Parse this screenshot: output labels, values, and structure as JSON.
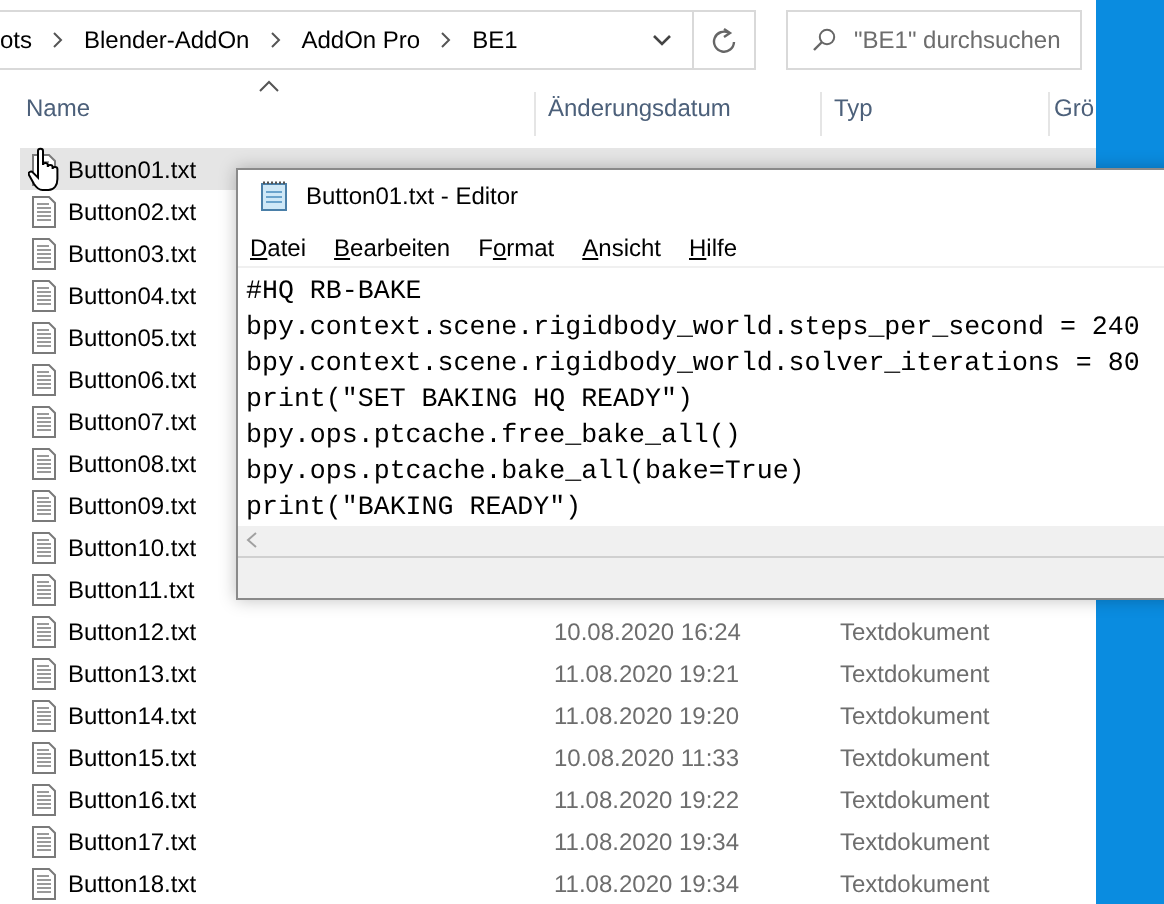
{
  "address_bar": {
    "path": [
      "ots",
      "Blender-AddOn",
      "AddOn Pro",
      "BE1"
    ]
  },
  "search": {
    "placeholder": "\"BE1\" durchsuchen"
  },
  "columns": [
    {
      "label": "Name",
      "sorted": true
    },
    {
      "label": "Änderungsdatum",
      "sorted": false
    },
    {
      "label": "Typ",
      "sorted": false
    },
    {
      "label": "Grö",
      "sorted": false
    }
  ],
  "files": [
    {
      "name": "Button01.txt",
      "hovered": true
    },
    {
      "name": "Button02.txt",
      "hovered": false
    },
    {
      "name": "Button03.txt",
      "hovered": false
    },
    {
      "name": "Button04.txt",
      "hovered": false
    },
    {
      "name": "Button05.txt",
      "hovered": false
    },
    {
      "name": "Button06.txt",
      "hovered": false
    },
    {
      "name": "Button07.txt",
      "hovered": false
    },
    {
      "name": "Button08.txt",
      "hovered": false
    },
    {
      "name": "Button09.txt",
      "hovered": false
    },
    {
      "name": "Button10.txt",
      "hovered": false
    },
    {
      "name": "Button11.txt",
      "hovered": false
    },
    {
      "name": "Button12.txt",
      "date": "10.08.2020 16:24",
      "type": "Textdokument",
      "hovered": false
    },
    {
      "name": "Button13.txt",
      "date": "11.08.2020 19:21",
      "type": "Textdokument",
      "hovered": false
    },
    {
      "name": "Button14.txt",
      "date": "11.08.2020 19:20",
      "type": "Textdokument",
      "hovered": false
    },
    {
      "name": "Button15.txt",
      "date": "10.08.2020 11:33",
      "type": "Textdokument",
      "hovered": false
    },
    {
      "name": "Button16.txt",
      "date": "11.08.2020 19:22",
      "type": "Textdokument",
      "hovered": false
    },
    {
      "name": "Button17.txt",
      "date": "11.08.2020 19:34",
      "type": "Textdokument",
      "hovered": false
    },
    {
      "name": "Button18.txt",
      "date": "11.08.2020 19:34",
      "type": "Textdokument",
      "hovered": false
    }
  ],
  "editor": {
    "title": "Button01.txt - Editor",
    "menu": [
      {
        "key": "D",
        "after": "atei"
      },
      {
        "key": "B",
        "after": "earbeiten"
      },
      {
        "before": "F",
        "key": "o",
        "after": "rmat"
      },
      {
        "key": "A",
        "after": "nsicht"
      },
      {
        "key": "H",
        "after": "ilfe"
      }
    ],
    "lines": [
      "#HQ RB-BAKE",
      "bpy.context.scene.rigidbody_world.steps_per_second = 240",
      "bpy.context.scene.rigidbody_world.solver_iterations = 80",
      "print(\"SET BAKING HQ READY\")",
      "bpy.ops.ptcache.free_bake_all()",
      "bpy.ops.ptcache.bake_all(bake=True)",
      "print(\"BAKING READY\")"
    ]
  }
}
